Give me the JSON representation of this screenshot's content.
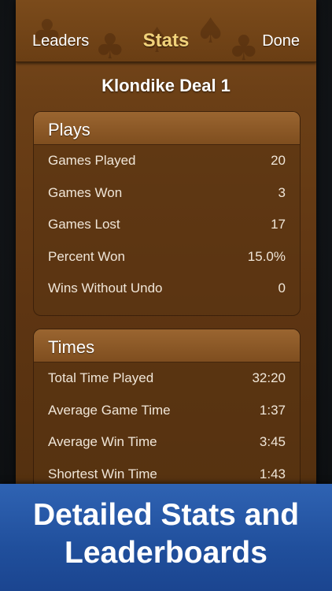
{
  "nav": {
    "left_label": "Leaders",
    "title": "Stats",
    "right_label": "Done"
  },
  "deal_title": "Klondike Deal 1",
  "plays": {
    "header": "Plays",
    "rows": [
      {
        "label": "Games Played",
        "value": "20"
      },
      {
        "label": "Games Won",
        "value": "3"
      },
      {
        "label": "Games Lost",
        "value": "17"
      },
      {
        "label": "Percent Won",
        "value": "15.0%"
      },
      {
        "label": "Wins Without Undo",
        "value": "0"
      }
    ]
  },
  "times": {
    "header": "Times",
    "rows": [
      {
        "label": "Total Time Played",
        "value": "32:20"
      },
      {
        "label": "Average Game Time",
        "value": "1:37"
      },
      {
        "label": "Average Win Time",
        "value": "3:45"
      },
      {
        "label": "Shortest Win Time",
        "value": "1:43"
      }
    ]
  },
  "banner": {
    "line1": "Detailed Stats and",
    "line2": "Leaderboards"
  },
  "colors": {
    "title_gold": "#f1d27b",
    "panel_brown": "#6b3f16",
    "banner_blue": "#2f63b3"
  }
}
